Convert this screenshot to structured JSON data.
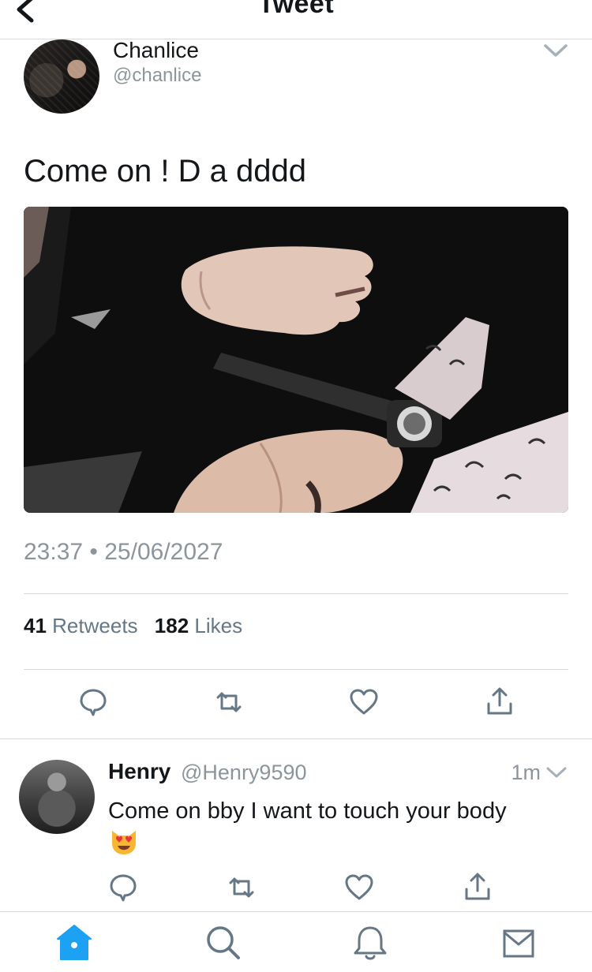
{
  "header": {
    "title": "Tweet",
    "back_icon": "chevron-left-icon"
  },
  "tweet": {
    "author": {
      "name": "Chanlice",
      "handle": "@chanlice"
    },
    "text": "Come on ! D a dddd",
    "media_alt": "",
    "timestamp": "23:37 • 25/06/2027",
    "stats": {
      "retweets_count": "41",
      "retweets_label": "Retweets",
      "likes_count": "182",
      "likes_label": "Likes"
    },
    "actions": [
      "reply-icon",
      "retweet-icon",
      "like-icon",
      "share-icon"
    ]
  },
  "reply": {
    "author": {
      "name": "Henry",
      "handle": "@Henry9590"
    },
    "time": "1m",
    "text": "Come on bby I want to touch your body",
    "emoji": "heart-eyes-cat-emoji",
    "actions": [
      "reply-icon",
      "retweet-icon",
      "like-icon",
      "share-icon"
    ]
  },
  "tabbar": {
    "items": [
      "home-icon",
      "search-icon",
      "notifications-icon",
      "messages-icon"
    ],
    "active": "home-icon"
  },
  "colors": {
    "accent": "#1da1f2",
    "text_primary": "#14171a",
    "text_secondary": "#8d959c",
    "icon_gray": "#657786",
    "divider": "#d7dadd"
  }
}
